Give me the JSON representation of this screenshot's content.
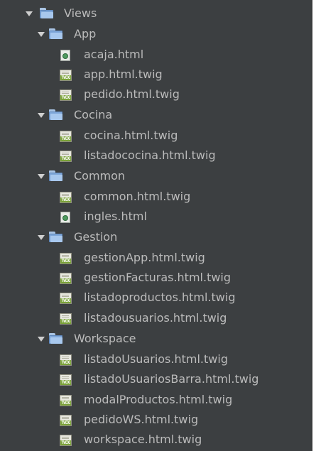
{
  "tree": {
    "root": {
      "label": "Views"
    },
    "folders": [
      {
        "label": "App",
        "files": [
          {
            "label": "acaja.html",
            "type": "html"
          },
          {
            "label": "app.html.twig",
            "type": "twig"
          },
          {
            "label": "pedido.html.twig",
            "type": "twig"
          }
        ]
      },
      {
        "label": "Cocina",
        "files": [
          {
            "label": "cocina.html.twig",
            "type": "twig"
          },
          {
            "label": "listadococina.html.twig",
            "type": "twig"
          }
        ]
      },
      {
        "label": "Common",
        "files": [
          {
            "label": "common.html.twig",
            "type": "twig"
          },
          {
            "label": "ingles.html",
            "type": "html"
          }
        ]
      },
      {
        "label": "Gestion",
        "files": [
          {
            "label": "gestionApp.html.twig",
            "type": "twig"
          },
          {
            "label": "gestionFacturas.html.twig",
            "type": "twig"
          },
          {
            "label": "listadoproductos.html.twig",
            "type": "twig"
          },
          {
            "label": "listadousuarios.html.twig",
            "type": "twig"
          }
        ]
      },
      {
        "label": "Workspace",
        "files": [
          {
            "label": "listadoUsuarios.html.twig",
            "type": "twig"
          },
          {
            "label": "listadoUsuariosBarra.html.twig",
            "type": "twig"
          },
          {
            "label": "modalProductos.html.twig",
            "type": "twig"
          },
          {
            "label": "pedidoWS.html.twig",
            "type": "twig"
          },
          {
            "label": "workspace.html.twig",
            "type": "twig"
          }
        ]
      }
    ],
    "twig_badge": "TWIG"
  },
  "colors": {
    "panel_background": "#3c3f41",
    "text": "#bbbbbb",
    "folder": "#7ea6d8",
    "twig_badge": "#7ba339"
  }
}
